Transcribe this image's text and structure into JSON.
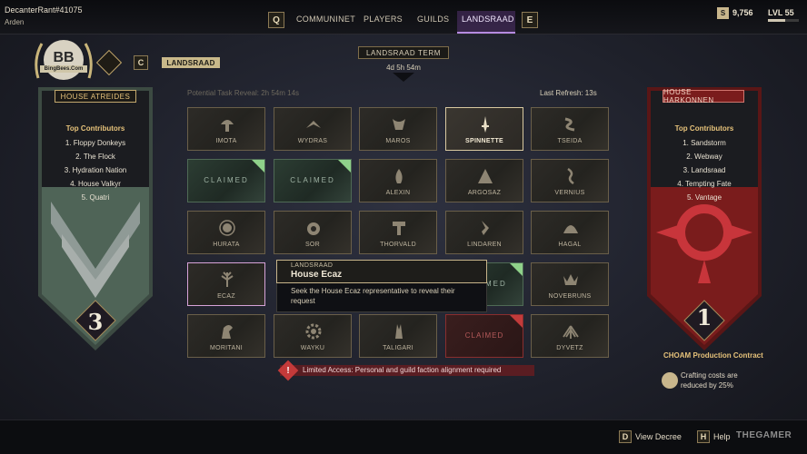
{
  "player": {
    "name": "DecanterRant#41075",
    "subtitle": "Arden"
  },
  "nav": {
    "left_key": "Q",
    "right_key": "E",
    "tabs": [
      {
        "label": "COMMUNINET",
        "active": false
      },
      {
        "label": "PLAYERS",
        "active": false
      },
      {
        "label": "GUILDS",
        "active": false
      },
      {
        "label": "LANDSRAAD",
        "active": true
      }
    ]
  },
  "status": {
    "currency": "9,756",
    "currency_icon": "S",
    "level": "LVL 55",
    "level_progress": 0.55
  },
  "watermark": {
    "text": "BingBees.Com"
  },
  "crest_area": {
    "key": "C",
    "tag": "LANDSRAAD"
  },
  "term": {
    "label": "LANDSRAAD TERM",
    "value": "4d 5h 54m"
  },
  "potential_reveal": "Potential Task Reveal: 2h 54m 14s",
  "last_refresh": "Last Refresh: 13s",
  "atreides": {
    "title": "HOUSE ATREIDES",
    "contributors_title": "Top Contributors",
    "contributors": [
      "1. Floppy Donkeys",
      "2. The Flock",
      "3. Hydration Nation",
      "4. House Valkyr",
      "5. Quatri"
    ],
    "rank": "3",
    "color": "#5e7a63"
  },
  "harkonnen": {
    "title": "HOUSE HARKONNEN",
    "contributors_title": "Top Contributors",
    "contributors": [
      "1. Sandstorm",
      "2. Webway",
      "3. Landsraad",
      "4. Tempting Fate",
      "5. Vantage"
    ],
    "rank": "1",
    "color": "#8a1f1f",
    "bonus_title": "CHOAM Production Contract",
    "bonus_desc": "Crafting costs are reduced by 25%"
  },
  "houses": [
    [
      {
        "name": "IMOTA",
        "state": "normal",
        "icon": "mushroom-icon"
      },
      {
        "name": "WYDRAS",
        "state": "normal",
        "icon": "bird-icon"
      },
      {
        "name": "MAROS",
        "state": "normal",
        "icon": "ram-icon"
      },
      {
        "name": "SPINNETTE",
        "state": "selected",
        "icon": "blade-icon"
      },
      {
        "name": "TSEIDA",
        "state": "normal",
        "icon": "wave-icon"
      }
    ],
    [
      {
        "name": "CLAIMED",
        "state": "claimed",
        "icon": ""
      },
      {
        "name": "CLAIMED",
        "state": "claimed",
        "icon": ""
      },
      {
        "name": "ALEXIN",
        "state": "normal",
        "icon": "flame-icon"
      },
      {
        "name": "ARGOSAZ",
        "state": "normal",
        "icon": "pyramid-icon"
      },
      {
        "name": "VERNIUS",
        "state": "normal",
        "icon": "helix-icon"
      }
    ],
    [
      {
        "name": "HURATA",
        "state": "normal",
        "icon": "sun-icon"
      },
      {
        "name": "SOR",
        "state": "normal",
        "icon": "orb-icon"
      },
      {
        "name": "THORVALD",
        "state": "normal",
        "icon": "hammer-icon"
      },
      {
        "name": "LINDAREN",
        "state": "normal",
        "icon": "feather-icon"
      },
      {
        "name": "HAGAL",
        "state": "normal",
        "icon": "fan-icon"
      }
    ],
    [
      {
        "name": "ECAZ",
        "state": "pink",
        "icon": "tree-icon"
      },
      {
        "name": "",
        "state": "hidden",
        "icon": ""
      },
      {
        "name": "",
        "state": "hidden",
        "icon": ""
      },
      {
        "name": "CLAIMED",
        "state": "claimed",
        "icon": ""
      },
      {
        "name": "NOVEBRUNS",
        "state": "normal",
        "icon": "crown-icon"
      }
    ],
    [
      {
        "name": "MORITANI",
        "state": "normal",
        "icon": "horse-icon"
      },
      {
        "name": "WAYKU",
        "state": "normal",
        "icon": "gear-icon"
      },
      {
        "name": "TALIGARI",
        "state": "normal",
        "icon": "tower-icon"
      },
      {
        "name": "CLAIMED",
        "state": "red",
        "icon": ""
      },
      {
        "name": "DYVETZ",
        "state": "normal",
        "icon": "wing-icon"
      }
    ]
  ],
  "tooltip": {
    "subtitle": "LANDSRAAD",
    "title": "House Ecaz",
    "description": "Seek the House Ecaz representative to reveal their request"
  },
  "limited_access": "Limited Access: Personal and guild faction alignment required",
  "hints": [
    {
      "key": "D",
      "label": "View Decree"
    },
    {
      "key": "H",
      "label": "Help"
    }
  ],
  "brand": "THEGAMER"
}
